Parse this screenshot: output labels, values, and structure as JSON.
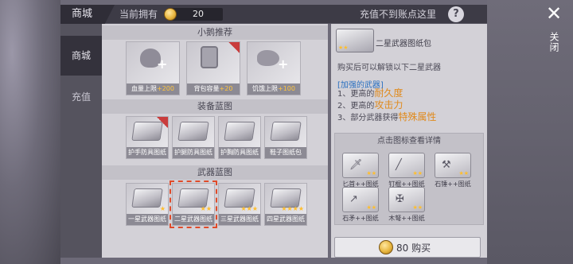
{
  "header": {
    "title": "商城",
    "owned_label": "当前拥有",
    "owned_value": "20",
    "recharge_text": "充值不到账点这里",
    "help": "?"
  },
  "close": {
    "icon": "✕",
    "label": "关闭"
  },
  "sidebar": {
    "tabs": [
      {
        "label": "商城"
      },
      {
        "label": "充值"
      }
    ]
  },
  "sections": [
    {
      "title": "小鹅推荐"
    },
    {
      "title": "装备蓝图"
    },
    {
      "title": "武器蓝图"
    }
  ],
  "recommend": [
    {
      "name": "血量上限",
      "bonus": "+200"
    },
    {
      "name": "背包容量",
      "bonus": "+20"
    },
    {
      "name": "饥饿上限",
      "bonus": "+100"
    }
  ],
  "equipment": [
    {
      "name": "护手防具图纸"
    },
    {
      "name": "护腿防具图纸"
    },
    {
      "name": "护胸防具图纸"
    },
    {
      "name": "鞋子图纸包"
    }
  ],
  "weapons": [
    {
      "name": "一星武器图纸",
      "stars": "★"
    },
    {
      "name": "二星武器图纸",
      "stars": "★★"
    },
    {
      "name": "三星武器图纸",
      "stars": "★★★"
    },
    {
      "name": "四星武器图纸",
      "stars": "★★★★"
    }
  ],
  "detail": {
    "pack_name": "二星武器图纸包",
    "pack_stars": "★★",
    "unlock": "购买后可以解锁以下二星武器",
    "feature_head": "[加强的武器]",
    "features": [
      {
        "prefix": "1、更高的",
        "highlight": "耐久度"
      },
      {
        "prefix": "2、更高的",
        "highlight": "攻击力"
      },
      {
        "prefix": "3、部分武器获得",
        "highlight": "特殊属性"
      }
    ],
    "click_hint": "点击图标查看详情",
    "weapons": [
      {
        "name": "匕首++图纸",
        "glyph": "🗡",
        "stars": "★★"
      },
      {
        "name": "钉棍++图纸",
        "glyph": "╱",
        "stars": "★★"
      },
      {
        "name": "石锤++图纸",
        "glyph": "⚒",
        "stars": "★★"
      },
      {
        "name": "石矛++图纸",
        "glyph": "↗",
        "stars": "★★"
      },
      {
        "name": "木弩++图纸",
        "glyph": "✠",
        "stars": "★★"
      }
    ],
    "buy_label": "80 购买"
  }
}
